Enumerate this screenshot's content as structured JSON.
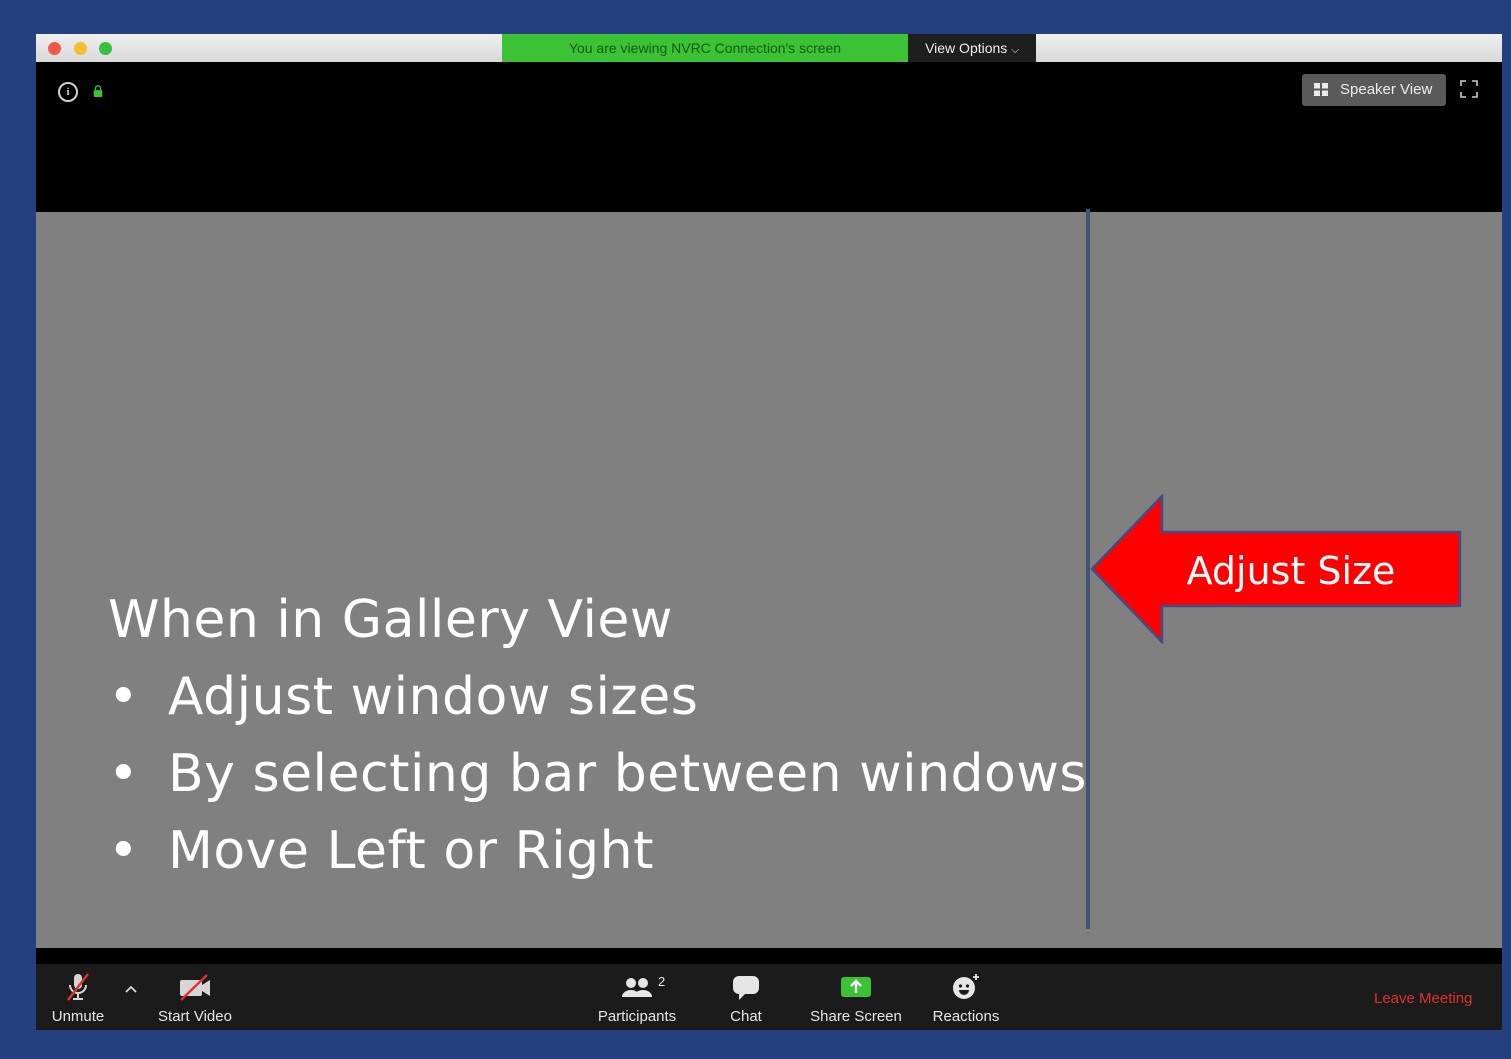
{
  "titlebar": {
    "viewing_banner": "You are viewing NVRC Connection's screen",
    "view_options": "View Options"
  },
  "top_controls": {
    "speaker_view": "Speaker View"
  },
  "slide": {
    "heading": "When in Gallery View",
    "bullets": [
      "Adjust window sizes",
      "By selecting bar between windows",
      "Move Left or Right"
    ],
    "bullet_char": "•",
    "arrow_label": "Adjust Size"
  },
  "toolbar": {
    "unmute": "Unmute",
    "start_video": "Start Video",
    "participants": "Participants",
    "participants_count": "2",
    "chat": "Chat",
    "share_screen": "Share Screen",
    "reactions": "Reactions",
    "leave_meeting": "Leave Meeting"
  },
  "colors": {
    "background": "#24407f",
    "banner_green": "#3bc235",
    "gallery_gray": "#808080",
    "arrow_red": "#ff0000",
    "leave_red": "#e0322d"
  },
  "icons": {
    "info": "info-icon",
    "lock": "lock-icon",
    "grid": "grid-icon",
    "fullscreen": "fullscreen-icon",
    "mic_muted": "mic-muted-icon",
    "video_off": "video-off-icon",
    "participants": "participants-icon",
    "chat": "chat-icon",
    "share": "share-screen-icon",
    "reactions": "reactions-icon"
  }
}
